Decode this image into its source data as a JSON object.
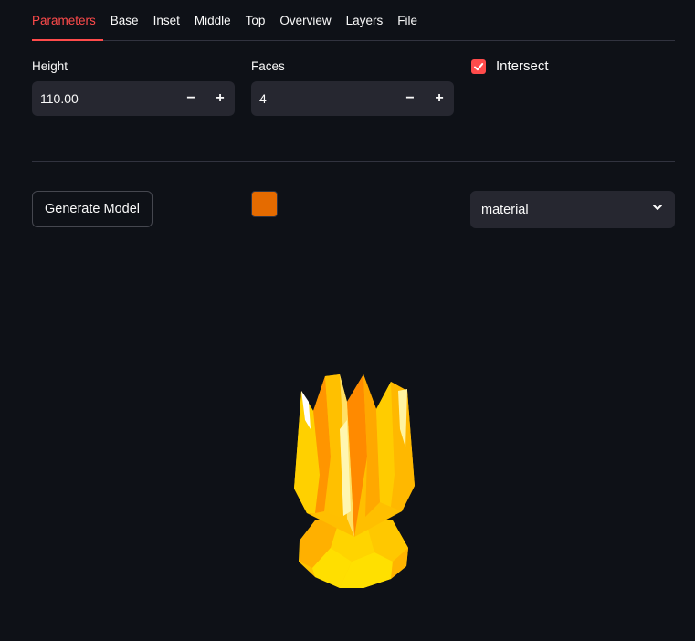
{
  "tabs": [
    {
      "label": "Parameters",
      "active": true
    },
    {
      "label": "Base",
      "active": false
    },
    {
      "label": "Inset",
      "active": false
    },
    {
      "label": "Middle",
      "active": false
    },
    {
      "label": "Top",
      "active": false
    },
    {
      "label": "Overview",
      "active": false
    },
    {
      "label": "Layers",
      "active": false
    },
    {
      "label": "File",
      "active": false
    }
  ],
  "height": {
    "label": "Height",
    "value": "110.00",
    "minus": "−",
    "plus": "+"
  },
  "faces": {
    "label": "Faces",
    "value": "4",
    "minus": "−",
    "plus": "+"
  },
  "intersect": {
    "label": "Intersect",
    "checked": true
  },
  "generate": {
    "label": "Generate Model"
  },
  "color_picker": {
    "value": "#e56b00"
  },
  "material_select": {
    "value": "material",
    "icon": "chevron-down-icon"
  },
  "colors": {
    "accent": "#ff4b4b",
    "background": "#0e1117",
    "input_bg": "#262730"
  }
}
